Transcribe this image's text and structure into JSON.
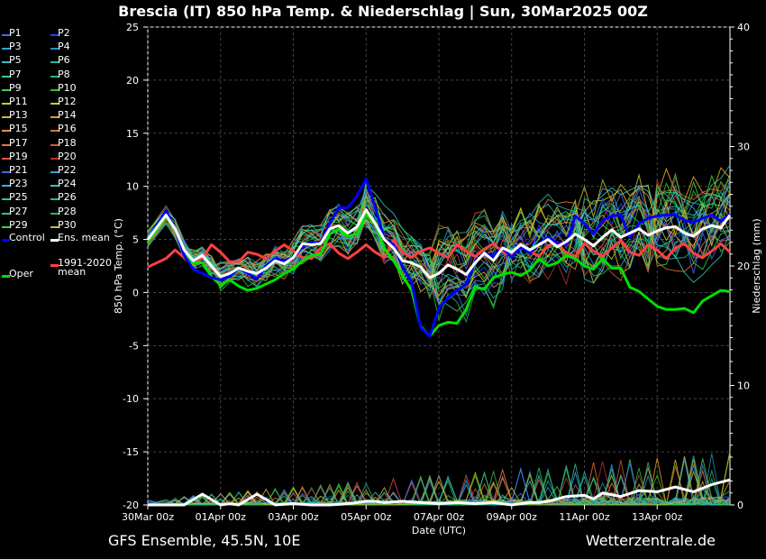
{
  "header": {
    "title": "Brescia  (IT)  850 hPa Temp. & Niederschlag | Sun, 30Mar2025 00Z"
  },
  "footer": {
    "left": "GFS Ensemble, 45.5N, 10E",
    "right": "Wetterzentrale.de"
  },
  "legend": [
    {
      "label": "P1",
      "color": "#3a6cff"
    },
    {
      "label": "P2",
      "color": "#2244ff"
    },
    {
      "label": "P3",
      "color": "#2a9fd8"
    },
    {
      "label": "P4",
      "color": "#1f8fc8"
    },
    {
      "label": "P5",
      "color": "#2ec4c4"
    },
    {
      "label": "P6",
      "color": "#22b8a8"
    },
    {
      "label": "P7",
      "color": "#2ad0a0"
    },
    {
      "label": "P8",
      "color": "#22b880"
    },
    {
      "label": "P9",
      "color": "#36d04a"
    },
    {
      "label": "P10",
      "color": "#2fbf30"
    },
    {
      "label": "P11",
      "color": "#b8d030"
    },
    {
      "label": "P12",
      "color": "#d0c830"
    },
    {
      "label": "P13",
      "color": "#e0b030"
    },
    {
      "label": "P14",
      "color": "#e0a028"
    },
    {
      "label": "P15",
      "color": "#e09050"
    },
    {
      "label": "P16",
      "color": "#c87a40"
    },
    {
      "label": "P17",
      "color": "#e07840"
    },
    {
      "label": "P18",
      "color": "#c86030"
    },
    {
      "label": "P19",
      "color": "#e05050"
    },
    {
      "label": "P20",
      "color": "#c03030"
    },
    {
      "label": "P21",
      "color": "#3a6cff"
    },
    {
      "label": "P22",
      "color": "#2a9fd8"
    },
    {
      "label": "P23",
      "color": "#3aa8e8"
    },
    {
      "label": "P24",
      "color": "#2ec4c4"
    },
    {
      "label": "P25",
      "color": "#22c8a0"
    },
    {
      "label": "P26",
      "color": "#22b8a0"
    },
    {
      "label": "P27",
      "color": "#30c870"
    },
    {
      "label": "P28",
      "color": "#2fb850"
    },
    {
      "label": "P29",
      "color": "#40d040"
    },
    {
      "label": "P30",
      "color": "#c8c020"
    },
    {
      "label": "Control",
      "color": "#0000ff"
    },
    {
      "label": "Ens. mean",
      "color": "#ffffff"
    },
    {
      "label": "Oper",
      "color": "#00e000"
    },
    {
      "label": "1991-2020\nmean",
      "color": "#ff4040"
    }
  ],
  "chart_data": {
    "type": "line",
    "title": "Brescia  (IT)  850 hPa Temp. & Niederschlag | Sun, 30Mar2025 00Z",
    "xlabel": "Date (UTC)",
    "ylabel": "850 hPa Temp. (°C)",
    "y2label": "Niederschlag (mm)",
    "xticks": [
      "30Mar 00z",
      "01Apr 00z",
      "03Apr 00z",
      "05Apr 00z",
      "07Apr 00z",
      "09Apr 00z",
      "11Apr 00z",
      "13Apr 00z"
    ],
    "xlim": [
      0,
      384
    ],
    "ylim": [
      -20,
      25
    ],
    "yticks": [
      -20,
      -15,
      -10,
      -5,
      0,
      5,
      10,
      15,
      20,
      25
    ],
    "y2lim": [
      0,
      40
    ],
    "y2ticks": [
      0,
      10,
      20,
      30,
      40
    ],
    "grid": true,
    "series": [
      {
        "name": "Ens. mean",
        "axis": "temp",
        "color": "#ffffff",
        "width": 3,
        "x": [
          0,
          12,
          18,
          24,
          30,
          36,
          42,
          48,
          54,
          60,
          66,
          72,
          78,
          84,
          90,
          96,
          102,
          108,
          114,
          120,
          126,
          132,
          138,
          144,
          150,
          156,
          162,
          168,
          174,
          180,
          186,
          192,
          198,
          204,
          210,
          216,
          222,
          228,
          234,
          240,
          246,
          252,
          258,
          264,
          270,
          276,
          282,
          288,
          294,
          300,
          306,
          312,
          318,
          324,
          330,
          336,
          342,
          348,
          354,
          360,
          366,
          372,
          378,
          384
        ],
        "y": [
          5,
          7.3,
          6,
          4,
          3,
          3.5,
          2.5,
          1.5,
          1.8,
          2.3,
          2,
          1.8,
          2.3,
          3,
          2.7,
          3.3,
          4.6,
          4.5,
          4.6,
          6,
          6.3,
          5.6,
          6.2,
          7.8,
          6.5,
          5,
          4.2,
          3,
          2.8,
          2.4,
          1.4,
          1.8,
          2.6,
          2.2,
          1.7,
          2.8,
          3.7,
          3,
          4.2,
          3.8,
          4.5,
          4,
          4.5,
          5,
          4.3,
          4.8,
          5.5,
          5,
          4.4,
          5.2,
          5.9,
          5.2,
          5.6,
          6,
          5.4,
          5.8,
          6.1,
          6.2,
          5.6,
          5.3,
          6,
          6.3,
          6.1,
          7.3
        ]
      },
      {
        "name": "Control",
        "axis": "temp",
        "color": "#0000ff",
        "width": 3,
        "x": [
          0,
          12,
          18,
          24,
          30,
          36,
          42,
          48,
          54,
          60,
          66,
          72,
          78,
          84,
          90,
          96,
          102,
          108,
          114,
          120,
          126,
          132,
          138,
          144,
          150,
          156,
          162,
          168,
          174,
          180,
          186,
          192,
          198,
          204,
          210,
          216,
          222,
          228,
          234,
          240,
          246,
          252,
          258,
          264,
          270,
          276,
          282,
          288,
          294,
          300,
          306,
          312,
          318,
          324,
          330,
          336,
          342,
          348,
          354,
          360,
          366,
          372,
          378,
          384
        ],
        "y": [
          5,
          7.7,
          6,
          3.5,
          2.2,
          1.8,
          1.4,
          1.2,
          1.5,
          2.3,
          1.8,
          1.3,
          2.5,
          3.2,
          3,
          3.3,
          4.3,
          4.7,
          4.7,
          6.5,
          8,
          8,
          9.1,
          10.7,
          8,
          5,
          4.5,
          2.4,
          1,
          -3.3,
          -4.1,
          -1.5,
          -0.5,
          0.2,
          0.8,
          2.9,
          3.7,
          3.4,
          4.2,
          3.3,
          4.3,
          3.7,
          4.6,
          5.2,
          4.7,
          4.5,
          7.2,
          6.5,
          5.5,
          6.8,
          7.2,
          7.3,
          5.2,
          6.5,
          7,
          7.2,
          7.3,
          7.3,
          6.8,
          6.6,
          7,
          7.3,
          6.7,
          7.4
        ]
      },
      {
        "name": "Oper",
        "axis": "temp",
        "color": "#00e000",
        "width": 3,
        "x": [
          0,
          12,
          18,
          24,
          30,
          36,
          42,
          48,
          54,
          60,
          66,
          72,
          78,
          84,
          90,
          96,
          102,
          108,
          114,
          120,
          126,
          132,
          138,
          144,
          150,
          156,
          162,
          168,
          174,
          180,
          186,
          192,
          198,
          204,
          210,
          216,
          222,
          228,
          234,
          240,
          246,
          252,
          258,
          264,
          270,
          276,
          282,
          288,
          294,
          300,
          306,
          312,
          318,
          324,
          330,
          336,
          342,
          348,
          354,
          360,
          366,
          372,
          378,
          384
        ],
        "y": [
          4.8,
          7.2,
          6,
          3.5,
          2.8,
          2.8,
          1.5,
          0.7,
          1.2,
          0.6,
          0.2,
          0.4,
          0.8,
          1.2,
          1.8,
          2.2,
          3,
          3.5,
          3.6,
          5.5,
          6,
          5.3,
          5.5,
          7.4,
          6.4,
          4.2,
          3,
          1.6,
          0.2,
          -3.2,
          -4.1,
          -3.1,
          -2.8,
          -2.9,
          -1.6,
          0.5,
          0.3,
          1.4,
          1.7,
          1.9,
          1.6,
          2.1,
          3.2,
          2.5,
          2.8,
          3.5,
          3.2,
          2.5,
          2.2,
          3.2,
          2.3,
          2.3,
          0.5,
          0.1,
          -0.6,
          -1.3,
          -1.6,
          -1.6,
          -1.5,
          -1.9,
          -0.8,
          -0.3,
          0.2,
          0.1
        ]
      },
      {
        "name": "1991-2020 mean",
        "axis": "temp",
        "color": "#ff4040",
        "width": 3,
        "x": [
          0,
          12,
          18,
          24,
          30,
          36,
          42,
          48,
          54,
          60,
          66,
          72,
          78,
          84,
          90,
          96,
          102,
          108,
          114,
          120,
          126,
          132,
          138,
          144,
          150,
          156,
          162,
          168,
          174,
          180,
          186,
          192,
          198,
          204,
          210,
          216,
          222,
          228,
          234,
          240,
          246,
          252,
          258,
          264,
          270,
          276,
          282,
          288,
          294,
          300,
          306,
          312,
          318,
          324,
          330,
          336,
          342,
          348,
          354,
          360,
          366,
          372,
          378,
          384
        ],
        "y": [
          2.4,
          3.2,
          4,
          3.3,
          2.9,
          3.2,
          4.5,
          3.8,
          2.9,
          2.9,
          3.8,
          3.6,
          3.2,
          3.9,
          4.5,
          3.9,
          3.3,
          3.2,
          4.2,
          4.6,
          3.7,
          3.2,
          3.8,
          4.5,
          3.8,
          3.3,
          4.9,
          3.8,
          3.3,
          3.9,
          4.2,
          3.7,
          3.3,
          4.5,
          3.9,
          3.4,
          4.1,
          4.6,
          3.8,
          3.5,
          4.6,
          3.9,
          3.4,
          4.4,
          4.7,
          3.7,
          3.4,
          4.6,
          3.9,
          3.4,
          4.2,
          4.9,
          3.8,
          3.5,
          4.5,
          4,
          3.2,
          4.2,
          4.6,
          3.7,
          3.3,
          3.9,
          4.6,
          3.8
        ]
      },
      {
        "name": "Ens. mean precip",
        "axis": "precip",
        "color": "#ffffff",
        "width": 3,
        "x": [
          0,
          12,
          24,
          36,
          48,
          54,
          60,
          72,
          84,
          96,
          108,
          120,
          132,
          144,
          150,
          156,
          168,
          180,
          192,
          204,
          216,
          228,
          240,
          252,
          258,
          264,
          276,
          288,
          294,
          300,
          312,
          324,
          336,
          348,
          360,
          372,
          384
        ],
        "y": [
          0,
          0,
          0,
          0.9,
          0,
          0.1,
          0,
          0.9,
          0,
          0.1,
          0,
          0,
          0.1,
          0.3,
          0.3,
          0.2,
          0.3,
          0.2,
          0.1,
          0.2,
          0.1,
          0.2,
          0,
          0.2,
          0.2,
          0.3,
          0.7,
          0.8,
          0.5,
          1,
          0.7,
          1.2,
          1.1,
          1.5,
          1.1,
          1.7,
          2.1
        ]
      }
    ],
    "members": [
      {
        "name": "P1",
        "color": "#3a6cff",
        "offsets": [
          0.3,
          -0.4,
          0.8,
          -1.2,
          1.5,
          0.6,
          -0.9,
          0.4
        ]
      },
      {
        "name": "P2",
        "color": "#2244ff",
        "offsets": [
          -0.2,
          0.6,
          -1,
          1.1,
          -1.4,
          0.8,
          1.9,
          -0.5
        ]
      },
      {
        "name": "P3",
        "color": "#2a9fd8",
        "offsets": [
          0.1,
          -0.7,
          1.2,
          0.9,
          -2,
          1.5,
          -1.1,
          2.4
        ]
      },
      {
        "name": "P4",
        "color": "#1f8fc8",
        "offsets": [
          -0.4,
          0.9,
          -0.6,
          1.8,
          0.7,
          -1.6,
          2.2,
          -0.9
        ]
      },
      {
        "name": "P5",
        "color": "#2ec4c4",
        "offsets": [
          0.5,
          -0.3,
          0.5,
          -0.8,
          2.5,
          -0.4,
          1.2,
          1.7
        ]
      },
      {
        "name": "P6",
        "color": "#22b8a8",
        "offsets": [
          -0.3,
          0.4,
          -1.1,
          0.6,
          -2.7,
          2.1,
          -0.8,
          -1.5
        ]
      },
      {
        "name": "P7",
        "color": "#2ad0a0",
        "offsets": [
          0.2,
          0.7,
          1.5,
          -1.7,
          1.1,
          -2.4,
          2.9,
          0.6
        ]
      },
      {
        "name": "P8",
        "color": "#22b880",
        "offsets": [
          -0.6,
          -0.5,
          0.3,
          1.3,
          -0.9,
          1.2,
          -2.1,
          3.1
        ]
      },
      {
        "name": "P9",
        "color": "#36d04a",
        "offsets": [
          0.4,
          0.2,
          -0.8,
          2.2,
          3.2,
          1.9,
          1.5,
          -2.2
        ]
      },
      {
        "name": "P10",
        "color": "#2fbf30",
        "offsets": [
          -0.1,
          -0.9,
          0.9,
          -0.3,
          -3.4,
          -1.1,
          0.8,
          2.7
        ]
      },
      {
        "name": "P11",
        "color": "#b8d030",
        "offsets": [
          0.6,
          0.5,
          -1.4,
          1.6,
          2,
          2.6,
          -1.7,
          1.1
        ]
      },
      {
        "name": "P12",
        "color": "#d0c830",
        "offsets": [
          -0.5,
          0.3,
          1.1,
          -1.4,
          -1.6,
          -0.7,
          3.6,
          -0.3
        ]
      },
      {
        "name": "P13",
        "color": "#e0b030",
        "offsets": [
          0.2,
          -0.6,
          -0.4,
          0.8,
          0.9,
          1.7,
          -2.6,
          4
        ]
      },
      {
        "name": "P14",
        "color": "#e0a028",
        "offsets": [
          -0.3,
          0.8,
          0.7,
          -0.6,
          2.8,
          -2,
          1.1,
          -1.2
        ]
      },
      {
        "name": "P15",
        "color": "#e09050",
        "offsets": [
          0.4,
          -0.2,
          -1.2,
          1.4,
          -2.3,
          0.9,
          2.4,
          0.4
        ]
      },
      {
        "name": "P16",
        "color": "#c87a40",
        "offsets": [
          -0.2,
          0.6,
          1.3,
          -1.1,
          1.4,
          -1.3,
          -1.4,
          2
        ]
      },
      {
        "name": "P17",
        "color": "#e07840",
        "offsets": [
          0.5,
          -0.8,
          -0.2,
          0.3,
          -1.1,
          2.8,
          0.5,
          -2.6
        ]
      },
      {
        "name": "P18",
        "color": "#c86030",
        "offsets": [
          -0.4,
          0.2,
          0.6,
          1.9,
          3.6,
          -0.2,
          -3,
          1.4
        ]
      },
      {
        "name": "P19",
        "color": "#e05050",
        "offsets": [
          0.1,
          0.4,
          -0.9,
          -1.5,
          -0.4,
          1.4,
          1.8,
          -0.8
        ]
      },
      {
        "name": "P20",
        "color": "#c03030",
        "offsets": [
          -0.6,
          -0.4,
          1,
          0.7,
          0.5,
          -2.7,
          -0.6,
          3.3
        ]
      },
      {
        "name": "P21",
        "color": "#3a6cff",
        "offsets": [
          0.3,
          0.7,
          -0.5,
          -0.9,
          -2.9,
          0.3,
          2.7,
          -1.9
        ]
      },
      {
        "name": "P22",
        "color": "#2a9fd8",
        "offsets": [
          -0.1,
          -0.3,
          1.4,
          1.2,
          2.3,
          2.3,
          -1.9,
          0.9
        ]
      },
      {
        "name": "P23",
        "color": "#3aa8e8",
        "offsets": [
          0.6,
          0.1,
          -1.3,
          -0.2,
          -0.6,
          -1.8,
          3.2,
          1.6
        ]
      },
      {
        "name": "P24",
        "color": "#2ec4c4",
        "offsets": [
          -0.5,
          0.9,
          0.2,
          2.4,
          1.7,
          1,
          -0.3,
          -2.8
        ]
      },
      {
        "name": "P25",
        "color": "#22c8a0",
        "offsets": [
          0.2,
          -0.5,
          0.8,
          -1.9,
          -1.9,
          -0.9,
          1.6,
          2.9
        ]
      },
      {
        "name": "P26",
        "color": "#22b8a0",
        "offsets": [
          -0.3,
          0.4,
          -0.7,
          0.4,
          3,
          3,
          -2.4,
          -0.1
        ]
      },
      {
        "name": "P27",
        "color": "#30c870",
        "offsets": [
          0.5,
          -0.7,
          1.2,
          1,
          -3.1,
          -1.5,
          0.3,
          1.3
        ]
      },
      {
        "name": "P28",
        "color": "#2fb850",
        "offsets": [
          -0.4,
          0.5,
          -1,
          -1.3,
          1.2,
          1.8,
          2.1,
          -1.6
        ]
      },
      {
        "name": "P29",
        "color": "#40d040",
        "offsets": [
          0.3,
          -0.1,
          0.4,
          1.7,
          -1.3,
          -0.5,
          -1.2,
          3.5
        ]
      },
      {
        "name": "P30",
        "color": "#c8c020",
        "offsets": [
          -0.2,
          0.8,
          -0.3,
          -0.7,
          2.6,
          2.4,
          4,
          0.8
        ]
      }
    ]
  }
}
